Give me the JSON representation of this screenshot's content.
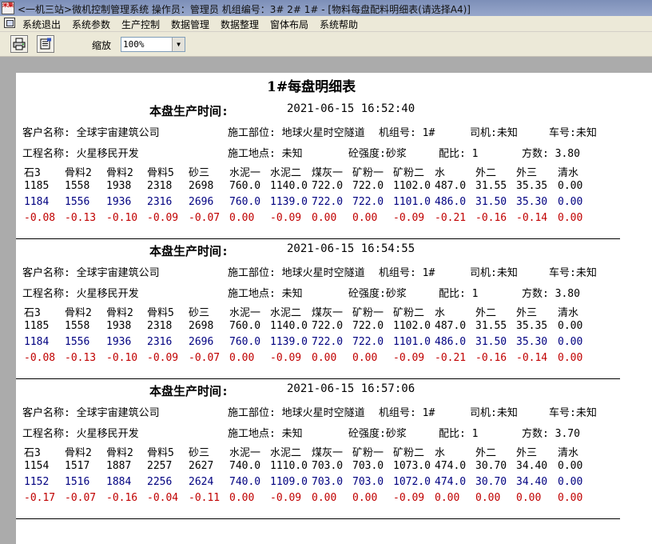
{
  "window": {
    "app_icon_text": "采集",
    "title": "<一机三站>微机控制管理系统    操作员：管理员    机组编号：3# 2# 1# - [物料每盘配料明细表(请选择A4)]"
  },
  "menu": [
    "系统退出",
    "系统参数",
    "生产控制",
    "数据管理",
    "数据整理",
    "窗体布局",
    "系统帮助"
  ],
  "toolbar": {
    "print_icon": "printer-icon",
    "export_icon": "export-icon",
    "zoom_label": "缩放",
    "zoom_value": "100%"
  },
  "report": {
    "title": "1#每盘明细表",
    "records": [
      {
        "time_label": "本盘生产时间:",
        "time": "2021-06-15 16:52:40",
        "customer": "客户名称: 全球宇宙建筑公司",
        "site": "施工部位: 地球火星时空隧道",
        "unit": "机组号: 1#",
        "driver": "司机:未知",
        "vehicle": "车号:未知",
        "project": "工程名称: 火星移民开发",
        "location": "施工地点:  未知",
        "strength": "砼强度:砂浆",
        "ratio": "配比: 1",
        "volume": "方数:  3.80",
        "headers": [
          "石3",
          "骨料2",
          "骨料2",
          "骨料5",
          "砂三",
          "水泥一",
          "水泥二",
          "煤灰一",
          "矿粉一",
          "矿粉二",
          "水",
          "外二",
          "外三",
          "清水"
        ],
        "row1": [
          "1185",
          "1558",
          "1938",
          "2318",
          "2698",
          "760.0",
          "1140.0",
          "722.0",
          "722.0",
          "1102.0",
          "487.0",
          "31.55",
          "35.35",
          "0.00"
        ],
        "row2": [
          "1184",
          "1556",
          "1936",
          "2316",
          "2696",
          "760.0",
          "1139.0",
          "722.0",
          "722.0",
          "1101.0",
          "486.0",
          "31.50",
          "35.30",
          "0.00"
        ],
        "row3": [
          "-0.08",
          "-0.13",
          "-0.10",
          "-0.09",
          "-0.07",
          "0.00",
          "-0.09",
          "0.00",
          "0.00",
          "-0.09",
          "-0.21",
          "-0.16",
          "-0.14",
          "0.00"
        ]
      },
      {
        "time_label": "本盘生产时间:",
        "time": "2021-06-15 16:54:55",
        "customer": "客户名称: 全球宇宙建筑公司",
        "site": "施工部位: 地球火星时空隧道",
        "unit": "机组号: 1#",
        "driver": "司机:未知",
        "vehicle": "车号:未知",
        "project": "工程名称: 火星移民开发",
        "location": "施工地点:  未知",
        "strength": "砼强度:砂浆",
        "ratio": "配比: 1",
        "volume": "方数:  3.80",
        "headers": [
          "石3",
          "骨料2",
          "骨料2",
          "骨料5",
          "砂三",
          "水泥一",
          "水泥二",
          "煤灰一",
          "矿粉一",
          "矿粉二",
          "水",
          "外二",
          "外三",
          "清水"
        ],
        "row1": [
          "1185",
          "1558",
          "1938",
          "2318",
          "2698",
          "760.0",
          "1140.0",
          "722.0",
          "722.0",
          "1102.0",
          "487.0",
          "31.55",
          "35.35",
          "0.00"
        ],
        "row2": [
          "1184",
          "1556",
          "1936",
          "2316",
          "2696",
          "760.0",
          "1139.0",
          "722.0",
          "722.0",
          "1101.0",
          "486.0",
          "31.50",
          "35.30",
          "0.00"
        ],
        "row3": [
          "-0.08",
          "-0.13",
          "-0.10",
          "-0.09",
          "-0.07",
          "0.00",
          "-0.09",
          "0.00",
          "0.00",
          "-0.09",
          "-0.21",
          "-0.16",
          "-0.14",
          "0.00"
        ]
      },
      {
        "time_label": "本盘生产时间:",
        "time": "2021-06-15 16:57:06",
        "customer": "客户名称: 全球宇宙建筑公司",
        "site": "施工部位: 地球火星时空隧道",
        "unit": "机组号: 1#",
        "driver": "司机:未知",
        "vehicle": "车号:未知",
        "project": "工程名称: 火星移民开发",
        "location": "施工地点:  未知",
        "strength": "砼强度:砂浆",
        "ratio": "配比: 1",
        "volume": "方数:  3.70",
        "headers": [
          "石3",
          "骨料2",
          "骨料2",
          "骨料5",
          "砂三",
          "水泥一",
          "水泥二",
          "煤灰一",
          "矿粉一",
          "矿粉二",
          "水",
          "外二",
          "外三",
          "清水"
        ],
        "row1": [
          "1154",
          "1517",
          "1887",
          "2257",
          "2627",
          "740.0",
          "1110.0",
          "703.0",
          "703.0",
          "1073.0",
          "474.0",
          "30.70",
          "34.40",
          "0.00"
        ],
        "row2": [
          "1152",
          "1516",
          "1884",
          "2256",
          "2624",
          "740.0",
          "1109.0",
          "703.0",
          "703.0",
          "1072.0",
          "474.0",
          "30.70",
          "34.40",
          "0.00"
        ],
        "row3": [
          "-0.17",
          "-0.07",
          "-0.16",
          "-0.04",
          "-0.11",
          "0.00",
          "-0.09",
          "0.00",
          "0.00",
          "-0.09",
          "0.00",
          "0.00",
          "0.00",
          "0.00"
        ]
      }
    ]
  },
  "colors": {
    "measured_row": "#000080",
    "deviation_row": "#c00000"
  }
}
